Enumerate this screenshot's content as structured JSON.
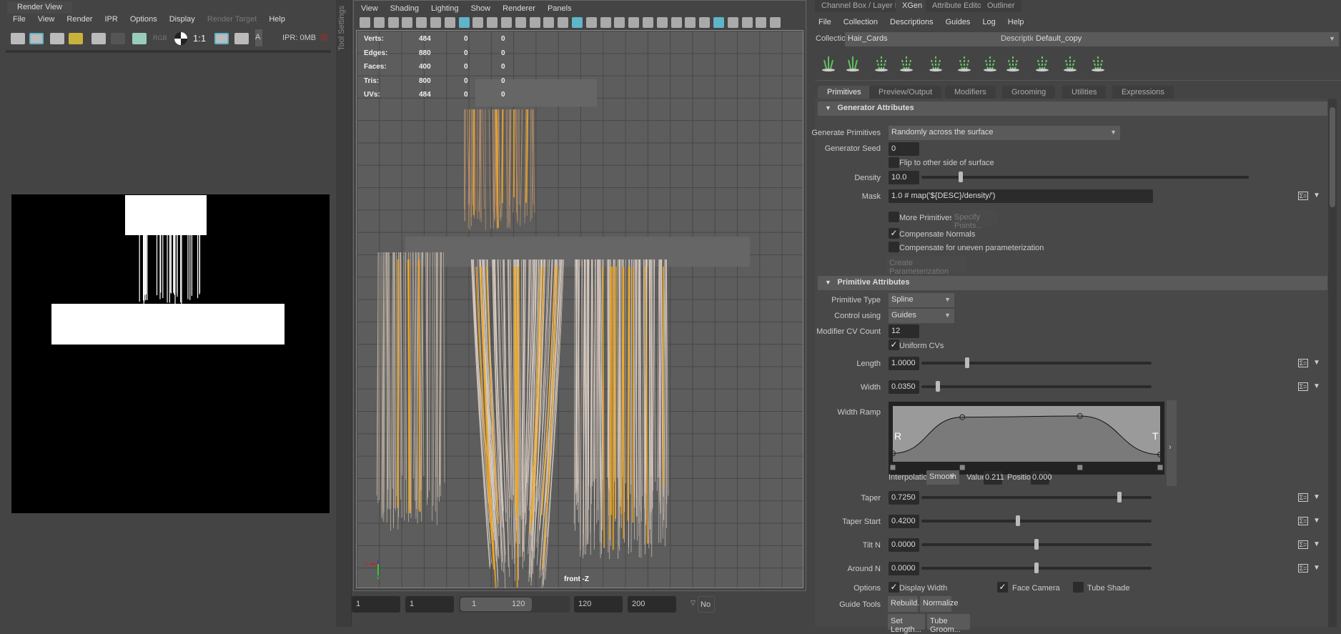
{
  "render_view": {
    "tab": "Render View",
    "menu": [
      "File",
      "View",
      "Render",
      "IPR",
      "Options",
      "Display",
      "Render Target",
      "Help"
    ],
    "zoom_label": "1:1",
    "ipr_status": "IPR: 0MB",
    "rgb": "RGB",
    "a": "A"
  },
  "tool_settings": "Tool Settings",
  "viewport": {
    "menu": [
      "View",
      "Shading",
      "Lighting",
      "Show",
      "Renderer",
      "Panels"
    ],
    "stats": [
      {
        "label": "Verts:",
        "v": [
          "484",
          "0",
          "0"
        ]
      },
      {
        "label": "Edges:",
        "v": [
          "880",
          "0",
          "0"
        ]
      },
      {
        "label": "Faces:",
        "v": [
          "400",
          "0",
          "0"
        ]
      },
      {
        "label": "Tris:",
        "v": [
          "800",
          "0",
          "0"
        ]
      },
      {
        "label": "UVs:",
        "v": [
          "484",
          "0",
          "0"
        ]
      }
    ],
    "camera_label": "front -Z",
    "axis": {
      "x": "x",
      "z": "z",
      "y": "y"
    }
  },
  "timeline": {
    "start": "1",
    "current": "1",
    "range_start": "1",
    "range_end": "120",
    "end": "120",
    "max": "200",
    "no": "No"
  },
  "xgen": {
    "tabs": [
      "Channel Box / Layer Editor",
      "XGen",
      "Attribute Editor",
      "Outliner"
    ],
    "menu": [
      "File",
      "Collection",
      "Descriptions",
      "Guides",
      "Log",
      "Help"
    ],
    "collection_label": "Collection",
    "collection": "Hair_Cards",
    "description_label": "Description",
    "description": "Default_copy",
    "ptabs": [
      "Primitives",
      "Preview/Output",
      "Modifiers",
      "Grooming",
      "Utilities",
      "Expressions"
    ],
    "gen_header": "Generator Attributes",
    "gen_prim_label": "Generate Primitives",
    "gen_prim": "Randomly across the surface",
    "seed_label": "Generator Seed",
    "seed": "0",
    "flip": "Flip to other side of surface",
    "density_label": "Density",
    "density": "10.0",
    "density_pos": 0.12,
    "mask_label": "Mask",
    "mask": "1.0 # map('${DESC}/density/')",
    "more_prims": "More Primitives at",
    "specify": "Specify Points...",
    "comp_normals": "Compensate Normals",
    "comp_uneven": "Compensate for uneven parameterization",
    "create_map": "Create Parameterization Map",
    "prim_header": "Primitive Attributes",
    "ptype_label": "Primitive Type",
    "ptype": "Spline",
    "control_label": "Control using",
    "control": "Guides",
    "cv_label": "Modifier CV Count",
    "cv": "12",
    "uniform": "Uniform CVs",
    "sliders": [
      {
        "label": "Length",
        "value": "1.0000",
        "pos": 0.2
      },
      {
        "label": "Width",
        "value": "0.0350",
        "pos": 0.07
      }
    ],
    "ramp": {
      "label": "Width Ramp",
      "r": "R",
      "t": "T",
      "points": [
        [
          0,
          0.15
        ],
        [
          0.26,
          0.8
        ],
        [
          0.7,
          0.82
        ],
        [
          1,
          0.13
        ]
      ],
      "interp_label": "Interpolation:",
      "interp": "Smooth",
      "value_label": "Value:",
      "value": "0.211",
      "position_label": "Position:",
      "position": "0.000"
    },
    "sliders2": [
      {
        "label": "Taper",
        "value": "0.7250",
        "pos": 0.86
      },
      {
        "label": "Taper Start",
        "value": "0.4200",
        "pos": 0.42
      },
      {
        "label": "Tilt N",
        "value": "0.0000",
        "pos": 0.5
      },
      {
        "label": "Around N",
        "value": "0.0000",
        "pos": 0.5
      }
    ],
    "options_label": "Options",
    "display_width": "Display Width",
    "face_camera": "Face Camera",
    "tube_shade": "Tube Shade",
    "guide_tools_label": "Guide Tools",
    "rebuild": "Rebuild...",
    "normalize": "Normalize",
    "set_length": "Set Length...",
    "tube_groom": "Tube Groom..."
  },
  "colors": {
    "accent": "#5fb5c9",
    "hair_guide": "#f0a820",
    "xgen_green": "#5cc25c"
  }
}
